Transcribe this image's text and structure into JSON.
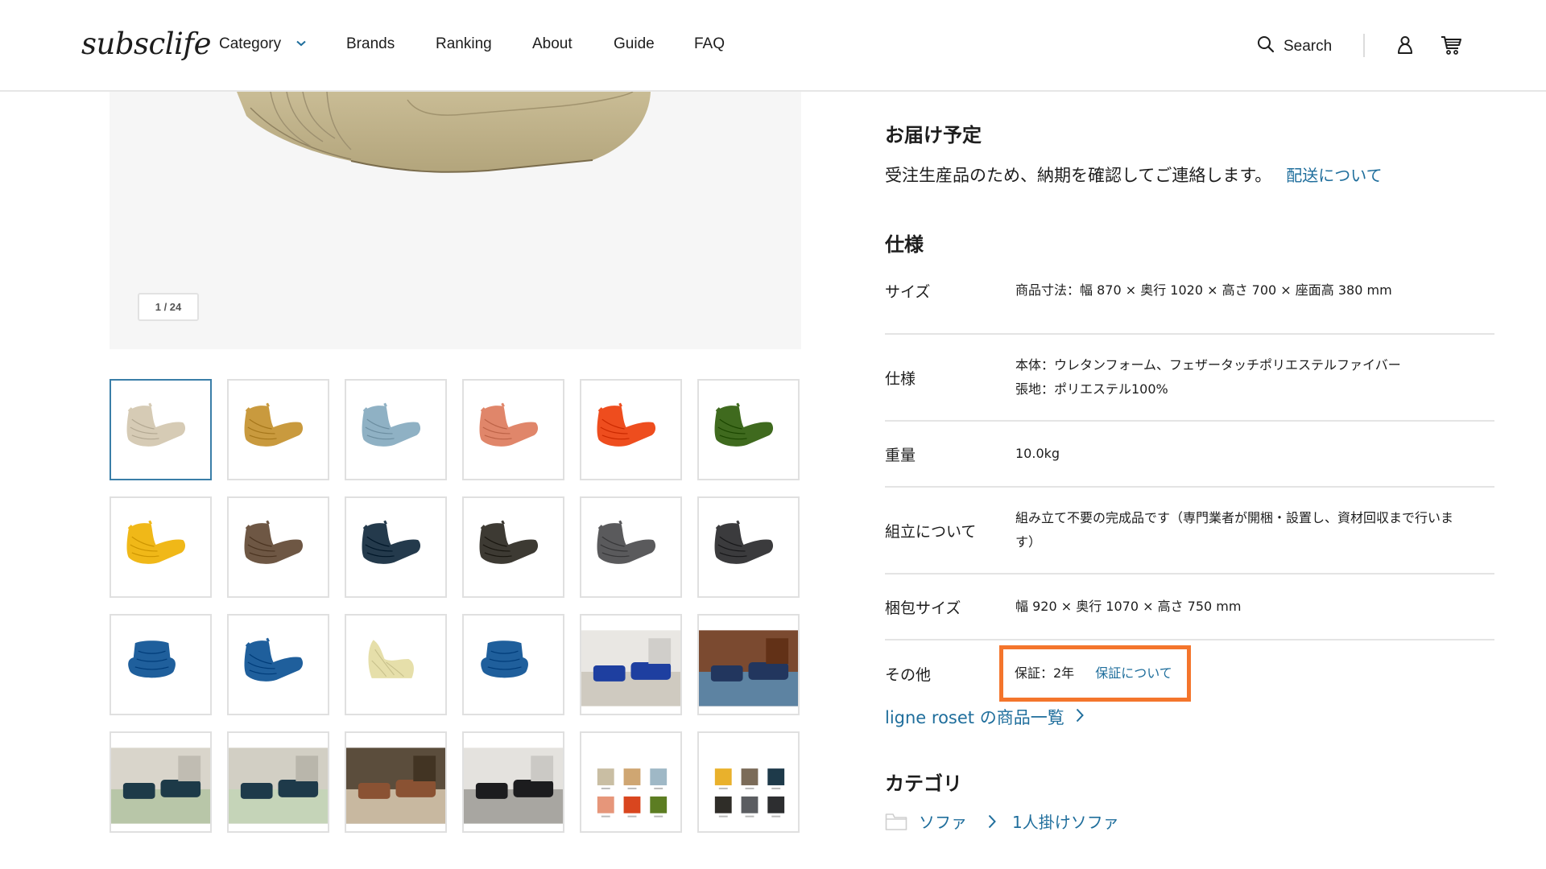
{
  "header": {
    "logo": "subsclife",
    "nav": [
      {
        "label": "Category",
        "has_dropdown": true
      },
      {
        "label": "Brands"
      },
      {
        "label": "Ranking"
      },
      {
        "label": "About"
      },
      {
        "label": "Guide"
      },
      {
        "label": "FAQ"
      }
    ],
    "search_label": "Search",
    "icons": [
      "search-icon",
      "user-icon",
      "cart-icon"
    ],
    "accent_color": "#1f6e9c"
  },
  "gallery": {
    "counter": "1 / 24",
    "current_index": 1,
    "total": 24,
    "thumbnails": [
      {
        "type": "chair",
        "color": "#d6cbb5",
        "selected": true
      },
      {
        "type": "chair",
        "color": "#c99a3e"
      },
      {
        "type": "chair",
        "color": "#8fb1c4"
      },
      {
        "type": "chair",
        "color": "#e0866a"
      },
      {
        "type": "chair",
        "color": "#ee4d1e"
      },
      {
        "type": "chair",
        "color": "#3f6a1e"
      },
      {
        "type": "chair",
        "color": "#f0b818"
      },
      {
        "type": "chair",
        "color": "#6e5744"
      },
      {
        "type": "chair",
        "color": "#243a4c"
      },
      {
        "type": "chair",
        "color": "#3d3a33"
      },
      {
        "type": "chair",
        "color": "#5a5a5c"
      },
      {
        "type": "chair",
        "color": "#3b3b3d"
      },
      {
        "type": "chair-front",
        "color": "#1f5f9c"
      },
      {
        "type": "chair",
        "color": "#1f5f9c"
      },
      {
        "type": "chair-side",
        "color": "#e6dfaa"
      },
      {
        "type": "chair-front",
        "color": "#1f5f9c"
      },
      {
        "type": "room",
        "palette": [
          "#e9e7e3",
          "#cfcac0",
          "#1e3fa0"
        ]
      },
      {
        "type": "room",
        "palette": [
          "#7b4a30",
          "#5d83a2",
          "#22365e"
        ]
      },
      {
        "type": "room",
        "palette": [
          "#d9d5cb",
          "#b8c6a8",
          "#1d3a48"
        ]
      },
      {
        "type": "room",
        "palette": [
          "#d2cfc4",
          "#c5d4b8",
          "#1e3a4a"
        ]
      },
      {
        "type": "room",
        "palette": [
          "#5b4d3c",
          "#c8b8a0",
          "#8a5233"
        ]
      },
      {
        "type": "room",
        "palette": [
          "#e4e2de",
          "#a8a6a1",
          "#1c1c1e"
        ]
      },
      {
        "type": "swatches",
        "colors": [
          "#c9bea3",
          "#cfa672",
          "#9fb8c6",
          "#e6967a",
          "#d9461f",
          "#5c7d22"
        ]
      },
      {
        "type": "swatches",
        "colors": [
          "#e9b12c",
          "#7b6b58",
          "#1e3a4a",
          "#2f2d28",
          "#5b5d61",
          "#2d2e30"
        ]
      }
    ]
  },
  "delivery": {
    "title": "お届け予定",
    "text": "受注生産品のため、納期を確認してご連絡します。",
    "link": "配送について"
  },
  "specs": {
    "title": "仕様",
    "rows": [
      {
        "label": "サイズ",
        "lines": [
          "商品寸法：幅 870 × 奥行 1020 × 高さ 700 × 座面高 380 mm"
        ]
      },
      {
        "label": "仕様",
        "lines": [
          "本体：ウレタンフォーム、フェザータッチポリエステルファイバー",
          "張地：ポリエステル100%"
        ]
      },
      {
        "label": "重量",
        "lines": [
          "10.0kg"
        ]
      },
      {
        "label": "組立について",
        "lines": [
          "組み立て不要の完成品です（専門業者が開梱・設置し、資材回収まで行いま",
          "す）"
        ]
      },
      {
        "label": "梱包サイズ",
        "lines": [
          "幅 920 × 奥行 1070 × 高さ 750 mm"
        ]
      },
      {
        "label": "その他",
        "value": "保証：2年",
        "link": "保証について",
        "highlighted": true,
        "highlight_color": "#f4752c"
      }
    ]
  },
  "brand_link": "ligne roset の商品一覧",
  "category": {
    "title": "カテゴリ",
    "breadcrumb": [
      "ソファ",
      "1人掛けソファ"
    ]
  }
}
